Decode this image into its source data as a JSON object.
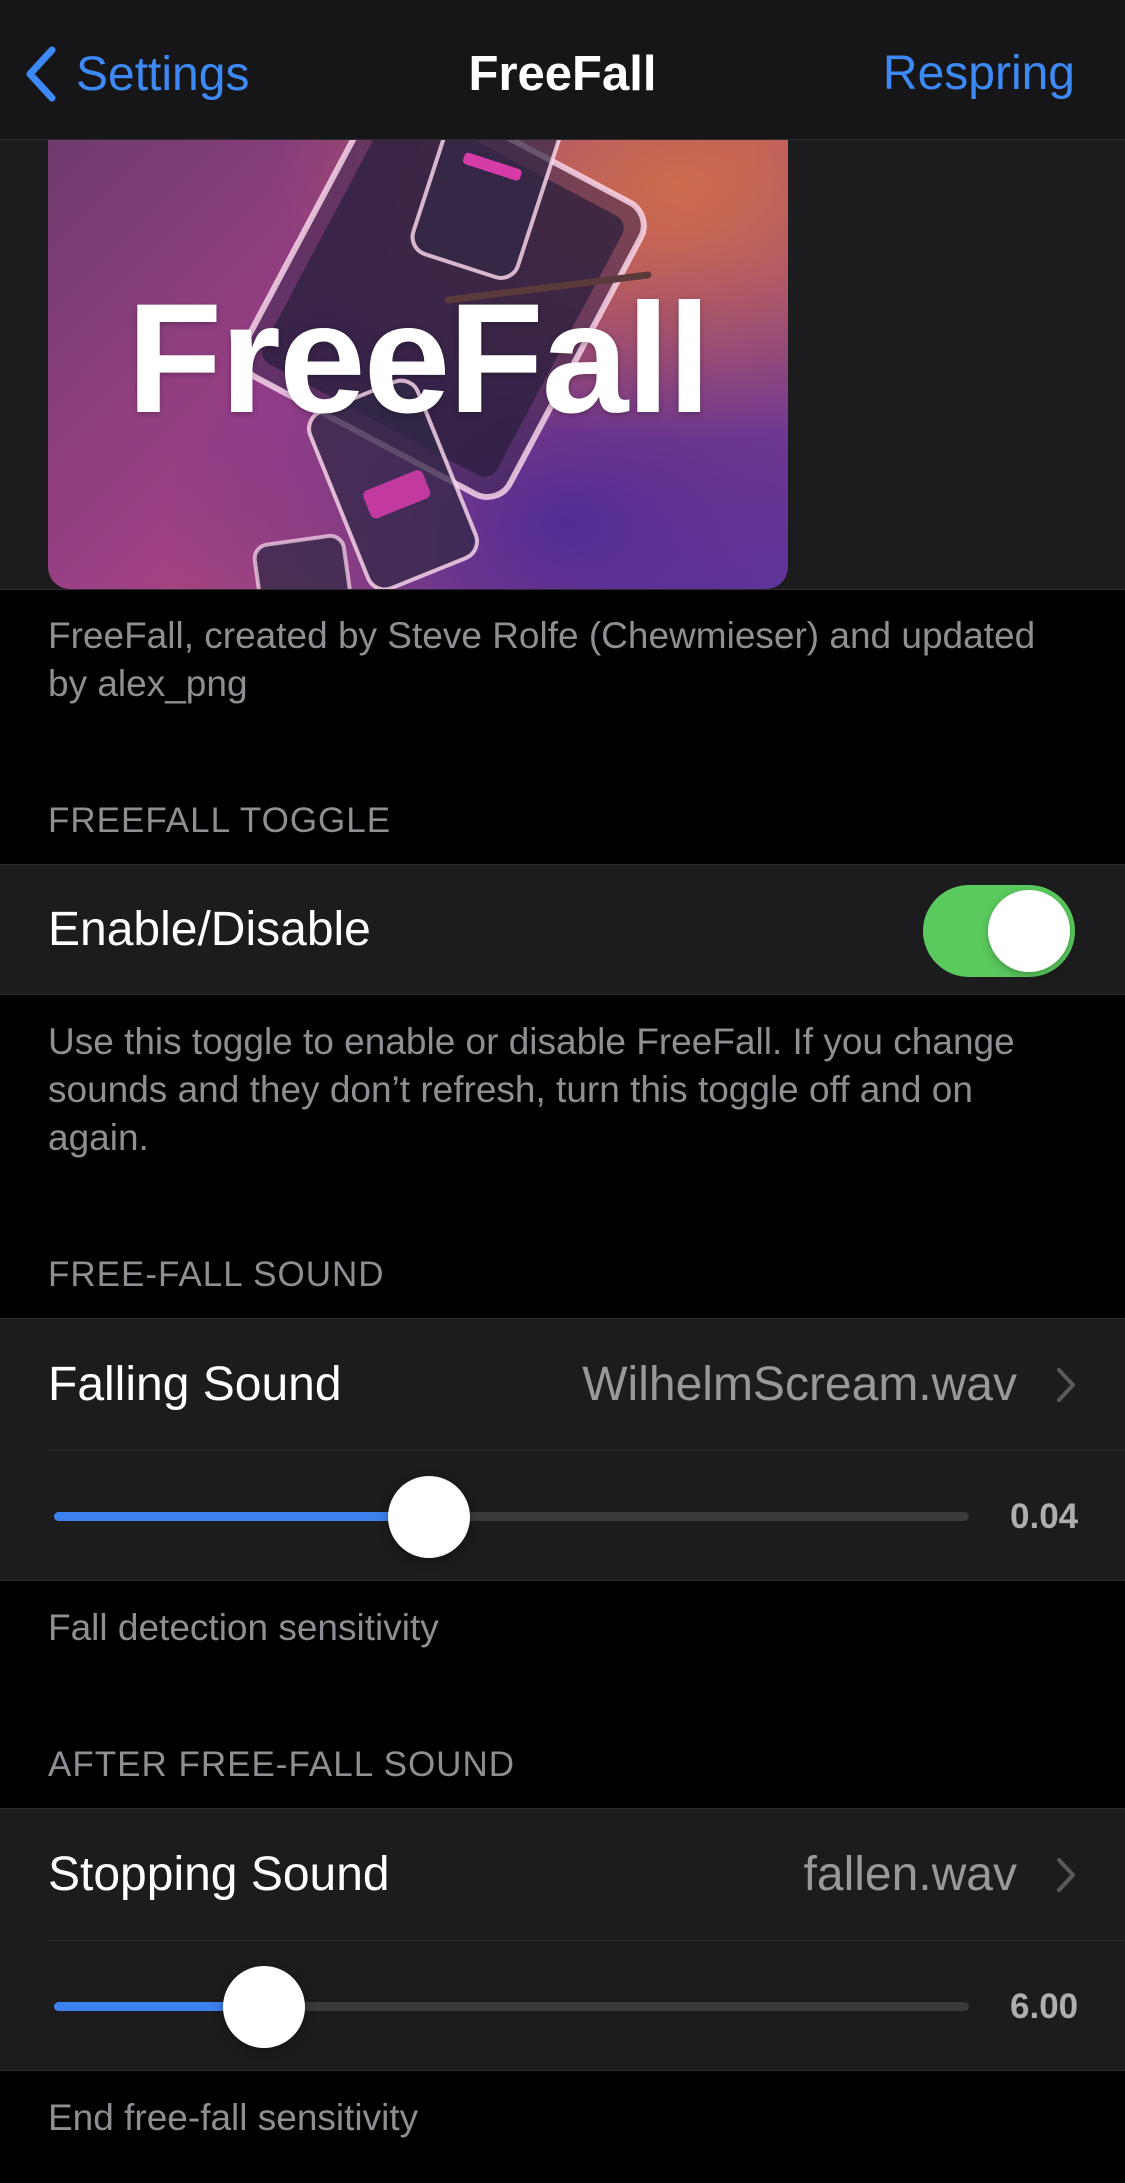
{
  "nav": {
    "back_label": "Settings",
    "title": "FreeFall",
    "right_label": "Respring"
  },
  "banner": {
    "word": "FreeFall"
  },
  "credits": "FreeFall, created by Steve Rolfe (Chewmieser) and updated by alex_png",
  "toggle_section": {
    "header": "FREEFALL TOGGLE",
    "label": "Enable/Disable",
    "enabled": true,
    "footer": "Use this toggle to enable or disable FreeFall. If you change sounds and they don’t refresh, turn this toggle off and on again."
  },
  "freefall_section": {
    "header": "FREE-FALL SOUND",
    "sound_label": "Falling Sound",
    "sound_value": "WilhelmScream.wav",
    "slider_fraction": 0.41,
    "slider_value_text": "0.04",
    "footer": "Fall detection sensitivity"
  },
  "after_section": {
    "header": "AFTER FREE-FALL SOUND",
    "sound_label": "Stopping Sound",
    "sound_value": "fallen.wav",
    "slider_fraction": 0.23,
    "slider_value_text": "6.00",
    "footer": "End free-fall sensitivity"
  },
  "colors": {
    "accent": "#3d8af7",
    "toggle_on": "#5ac95e",
    "slider_fill": "#3d80f0"
  },
  "icons": {
    "back": "chevron-left-icon",
    "disclosure": "chevron-right-icon"
  }
}
